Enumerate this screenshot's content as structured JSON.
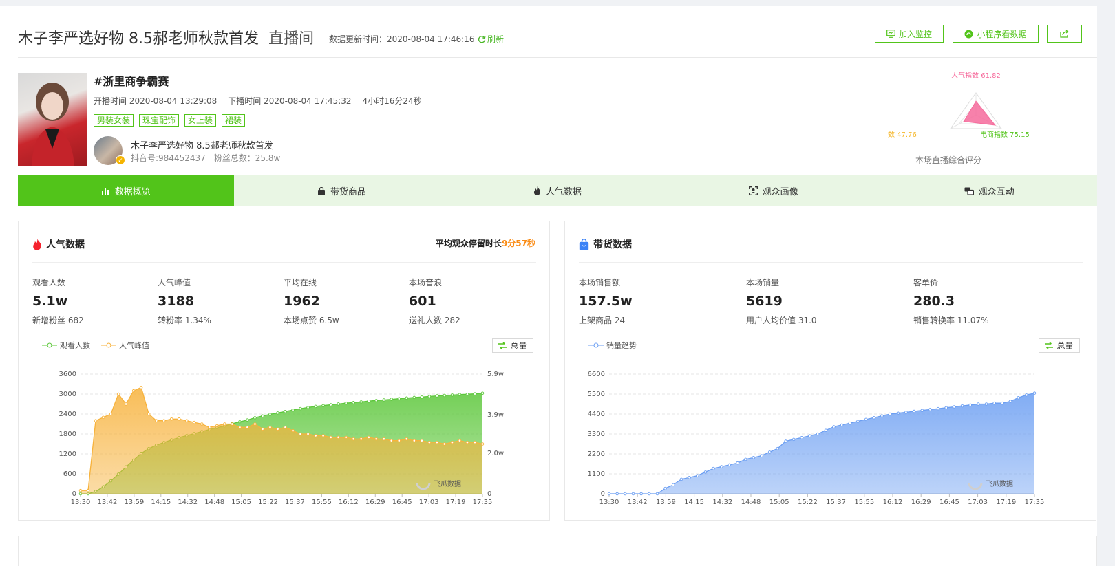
{
  "header": {
    "title": "木子李严选好物 8.5郝老师秋款首发",
    "title_suffix": "直播间",
    "update_label": "数据更新时间：",
    "update_time": "2020-08-04 17:46:16",
    "refresh_label": "刷新",
    "buttons": {
      "monitor": "加入监控",
      "mini_program": "小程序看数据"
    }
  },
  "stream": {
    "topic": "#浙里商争霸赛",
    "start": "开播时间 2020-08-04 13:29:08",
    "end": "下播时间 2020-08-04 17:45:32",
    "duration": "4小时16分24秒",
    "tags": [
      "男装女装",
      "珠宝配饰",
      "女上装",
      "裙装"
    ],
    "anchor_name": "木子李严选好物 8.5郝老师秋款首发",
    "douyin_id": "抖音号:984452437",
    "fans": "粉丝总数：25.8w"
  },
  "score": {
    "popularity": "人气指数 61.82",
    "revenue": "收益指数 47.76",
    "ecommerce": "电商指数 75.15",
    "caption": "本场直播综合评分",
    "values": {
      "popularity": 61.82,
      "revenue": 47.76,
      "ecommerce": 75.15
    },
    "colors": {
      "popularity": "#f66b9c",
      "revenue": "#f5b82e",
      "ecommerce": "#52c41a"
    }
  },
  "tabs": [
    {
      "label": "数据概览",
      "icon": "bar-chart-icon",
      "active": true
    },
    {
      "label": "带货商品",
      "icon": "shopping-bag-icon",
      "active": false
    },
    {
      "label": "人气数据",
      "icon": "flame-icon",
      "active": false
    },
    {
      "label": "观众画像",
      "icon": "portrait-scan-icon",
      "active": false
    },
    {
      "label": "观众互动",
      "icon": "chat-icon",
      "active": false
    }
  ],
  "popularity": {
    "title": "人气数据",
    "avg_stay_label": "平均观众停留时长",
    "avg_stay_value": "9分57秒",
    "stats": [
      {
        "label": "观看人数",
        "value": "5.1w",
        "sub": "新增粉丝 682"
      },
      {
        "label": "人气峰值",
        "value": "3188",
        "sub": "转粉率 1.34%"
      },
      {
        "label": "平均在线",
        "value": "1962",
        "sub": "本场点赞 6.5w"
      },
      {
        "label": "本场音浪",
        "value": "601",
        "sub": "送礼人数 282"
      }
    ],
    "legend": [
      "观看人数",
      "人气峰值"
    ],
    "total_button": "总量"
  },
  "sales": {
    "title": "带货数据",
    "stats": [
      {
        "label": "本场销售额",
        "value": "157.5w",
        "sub": "上架商品 24"
      },
      {
        "label": "本场销量",
        "value": "5619",
        "sub": "用户人均价值 31.0"
      },
      {
        "label": "客单价",
        "value": "280.3",
        "sub": "销售转换率 11.07%"
      }
    ],
    "legend": [
      "销量趋势"
    ],
    "total_button": "总量"
  },
  "watermark": "飞瓜数据",
  "chart_data": [
    {
      "type": "area",
      "x_ticks": [
        "13:30",
        "13:42",
        "13:59",
        "14:15",
        "14:32",
        "14:48",
        "15:05",
        "15:22",
        "15:37",
        "15:55",
        "16:12",
        "16:29",
        "16:45",
        "17:03",
        "17:19",
        "17:35"
      ],
      "y_left_ticks": [
        0,
        600,
        1200,
        1800,
        2400,
        3000,
        3600
      ],
      "y_right_ticks": [
        "0",
        "2.0w",
        "3.9w",
        "5.9w"
      ],
      "ylim_left": [
        0,
        3600
      ],
      "ylim_right": [
        0,
        59000
      ],
      "grid": true,
      "colors": {
        "观看人数": "#5cc73a",
        "人气峰值": "#f7b23b"
      },
      "series": [
        {
          "name": "观看人数",
          "axis": "right",
          "values": [
            0,
            0,
            1200,
            3500,
            6400,
            9700,
            13300,
            16600,
            19900,
            22300,
            24000,
            25300,
            26600,
            27700,
            28700,
            29700,
            30700,
            31700,
            32600,
            33500,
            34600,
            35500,
            36400,
            37500,
            38400,
            39200,
            39900,
            40600,
            41300,
            42000,
            42600,
            43100,
            43500,
            43900,
            44300,
            44700,
            45000,
            45300,
            45700,
            46000,
            46300,
            46600,
            46900,
            47200,
            47500,
            47700,
            48000,
            48300,
            48500,
            48700,
            48900,
            49100,
            49300,
            49600
          ]
        },
        {
          "name": "人气峰值",
          "axis": "left",
          "values": [
            100,
            100,
            2200,
            2300,
            2400,
            3000,
            2700,
            3100,
            3200,
            2400,
            2200,
            2200,
            2250,
            2250,
            2200,
            2150,
            2100,
            2000,
            2050,
            2100,
            2100,
            2000,
            2000,
            2100,
            1950,
            2000,
            1950,
            2000,
            1900,
            1800,
            1800,
            1750,
            1750,
            1700,
            1700,
            1700,
            1650,
            1650,
            1700,
            1650,
            1650,
            1600,
            1600,
            1650,
            1600,
            1600,
            1550,
            1550,
            1500,
            1550,
            1600,
            1550,
            1550,
            1500
          ]
        }
      ]
    },
    {
      "type": "area",
      "x_ticks": [
        "13:30",
        "13:42",
        "13:59",
        "14:15",
        "14:32",
        "14:48",
        "15:05",
        "15:22",
        "15:37",
        "15:55",
        "16:12",
        "16:29",
        "16:45",
        "17:03",
        "17:19",
        "17:35"
      ],
      "y_ticks": [
        0,
        1100,
        2200,
        3300,
        4400,
        5500,
        6600
      ],
      "ylim": [
        0,
        6600
      ],
      "grid": true,
      "colors": {
        "销量趋势": "#6b9ef2"
      },
      "series": [
        {
          "name": "销量趋势",
          "values": [
            0,
            0,
            0,
            0,
            0,
            0,
            0,
            300,
            500,
            800,
            900,
            1000,
            1200,
            1400,
            1500,
            1600,
            1700,
            1900,
            2000,
            2100,
            2300,
            2500,
            2900,
            3000,
            3100,
            3200,
            3300,
            3500,
            3700,
            3800,
            3900,
            4000,
            4100,
            4200,
            4300,
            4400,
            4450,
            4500,
            4550,
            4600,
            4650,
            4700,
            4750,
            4800,
            4850,
            4900,
            4950,
            4950,
            5000,
            5000,
            5100,
            5300,
            5450,
            5550
          ]
        }
      ]
    }
  ]
}
